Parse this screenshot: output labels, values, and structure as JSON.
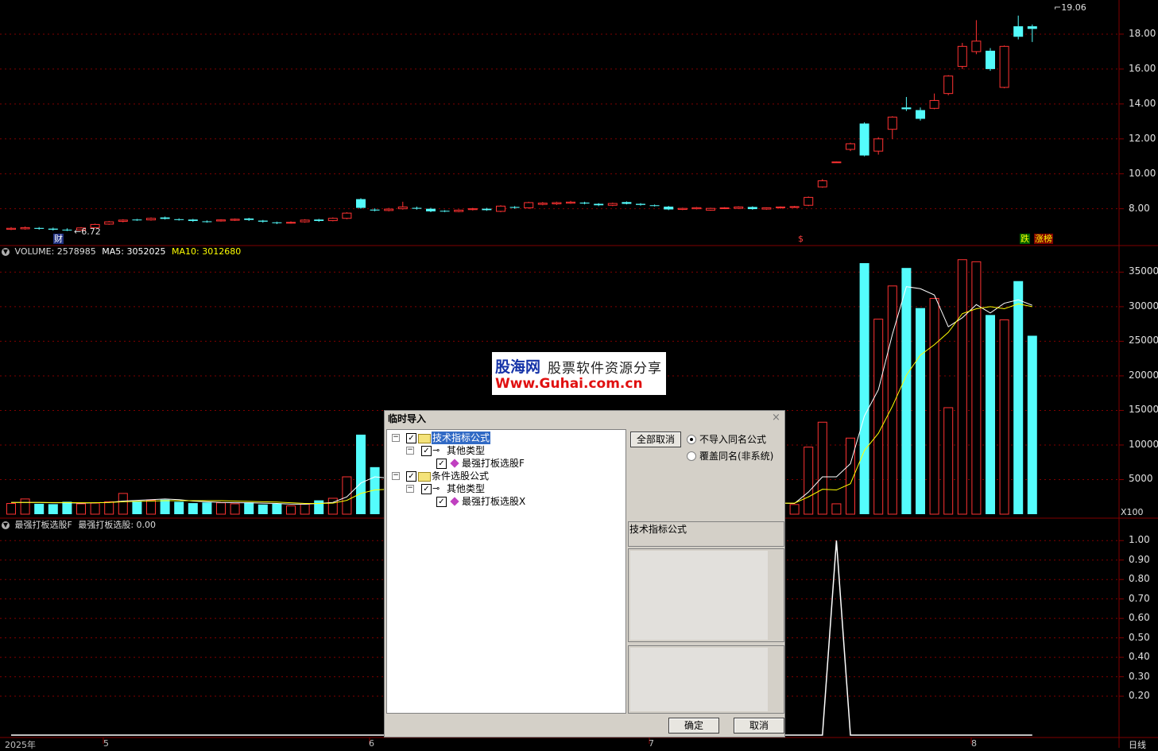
{
  "colors": {
    "up": "#ff3232",
    "down": "#54fcfc",
    "grid": "#800000",
    "ma5": "#ffffff",
    "ma10": "#ffff00",
    "vol_up": "#ff3232",
    "vol_down": "#54fcfc"
  },
  "price_axis": {
    "ticks": [
      "18.00",
      "16.00",
      "14.00",
      "12.00",
      "10.00",
      "8.00"
    ],
    "range": [
      6.3,
      19.5
    ]
  },
  "price_annotations": {
    "low": "6.72",
    "high": "19.06",
    "markers": [
      "财",
      "$",
      "跌",
      "涨榜"
    ]
  },
  "volume_panel": {
    "header_label": "VOLUME: 2578985",
    "ma5_label": "MA5: 3052025",
    "ma10_label": "MA10: 3012680",
    "ticks": [
      "35000",
      "30000",
      "25000",
      "20000",
      "15000",
      "10000",
      "5000"
    ],
    "unit": "X100",
    "range": [
      0,
      37000
    ]
  },
  "indicator_panel": {
    "header_name": "最强打板选股F",
    "header_value": "最强打板选股: 0.00",
    "ticks": [
      "1.00",
      "0.90",
      "0.80",
      "0.70",
      "0.60",
      "0.50",
      "0.40",
      "0.30",
      "0.20"
    ],
    "range": [
      0,
      1.05
    ]
  },
  "x_axis": {
    "labels": [
      "2025年",
      "5",
      "6",
      "7",
      "8"
    ],
    "period": "日线"
  },
  "chart_data": {
    "type": "candlestick",
    "title": "",
    "candles": [
      {
        "o": 6.82,
        "c": 6.88,
        "h": 6.95,
        "l": 6.78
      },
      {
        "o": 6.85,
        "c": 6.92,
        "h": 6.98,
        "l": 6.8
      },
      {
        "o": 6.9,
        "c": 6.85,
        "h": 6.95,
        "l": 6.8
      },
      {
        "o": 6.86,
        "c": 6.8,
        "h": 6.92,
        "l": 6.75
      },
      {
        "o": 6.8,
        "c": 6.78,
        "h": 6.88,
        "l": 6.72
      },
      {
        "o": 6.78,
        "c": 6.9,
        "h": 6.95,
        "l": 6.75
      },
      {
        "o": 6.92,
        "c": 7.1,
        "h": 7.15,
        "l": 6.9
      },
      {
        "o": 7.12,
        "c": 7.25,
        "h": 7.3,
        "l": 7.08
      },
      {
        "o": 7.28,
        "c": 7.35,
        "h": 7.4,
        "l": 7.22
      },
      {
        "o": 7.38,
        "c": 7.34,
        "h": 7.42,
        "l": 7.3
      },
      {
        "o": 7.36,
        "c": 7.45,
        "h": 7.5,
        "l": 7.32
      },
      {
        "o": 7.5,
        "c": 7.42,
        "h": 7.55,
        "l": 7.38
      },
      {
        "o": 7.4,
        "c": 7.36,
        "h": 7.45,
        "l": 7.32
      },
      {
        "o": 7.38,
        "c": 7.3,
        "h": 7.42,
        "l": 7.25
      },
      {
        "o": 7.28,
        "c": 7.26,
        "h": 7.33,
        "l": 7.2
      },
      {
        "o": 7.3,
        "c": 7.36,
        "h": 7.4,
        "l": 7.26
      },
      {
        "o": 7.34,
        "c": 7.4,
        "h": 7.44,
        "l": 7.3
      },
      {
        "o": 7.44,
        "c": 7.36,
        "h": 7.48,
        "l": 7.3
      },
      {
        "o": 7.32,
        "c": 7.26,
        "h": 7.36,
        "l": 7.2
      },
      {
        "o": 7.22,
        "c": 7.18,
        "h": 7.26,
        "l": 7.12
      },
      {
        "o": 7.18,
        "c": 7.22,
        "h": 7.28,
        "l": 7.14
      },
      {
        "o": 7.25,
        "c": 7.35,
        "h": 7.4,
        "l": 7.2
      },
      {
        "o": 7.38,
        "c": 7.3,
        "h": 7.42,
        "l": 7.25
      },
      {
        "o": 7.32,
        "c": 7.45,
        "h": 7.5,
        "l": 7.28
      },
      {
        "o": 7.45,
        "c": 7.75,
        "h": 7.8,
        "l": 7.4
      },
      {
        "o": 8.55,
        "c": 8.05,
        "h": 8.6,
        "l": 8.0
      },
      {
        "o": 7.95,
        "c": 7.9,
        "h": 8.02,
        "l": 7.85
      },
      {
        "o": 7.9,
        "c": 7.98,
        "h": 8.05,
        "l": 7.85
      },
      {
        "o": 8.0,
        "c": 8.1,
        "h": 8.4,
        "l": 7.95
      },
      {
        "o": 8.05,
        "c": 8.0,
        "h": 8.12,
        "l": 7.95
      },
      {
        "o": 8.0,
        "c": 7.85,
        "h": 8.05,
        "l": 7.8
      },
      {
        "o": 7.88,
        "c": 7.84,
        "h": 7.92,
        "l": 7.8
      },
      {
        "o": 7.84,
        "c": 7.92,
        "h": 7.96,
        "l": 7.8
      },
      {
        "o": 7.95,
        "c": 8.0,
        "h": 8.05,
        "l": 7.9
      },
      {
        "o": 8.0,
        "c": 7.92,
        "h": 8.05,
        "l": 7.88
      },
      {
        "o": 7.85,
        "c": 8.15,
        "h": 8.2,
        "l": 7.8
      },
      {
        "o": 8.1,
        "c": 8.05,
        "h": 8.15,
        "l": 8.0
      },
      {
        "o": 8.05,
        "c": 8.35,
        "h": 8.4,
        "l": 8.0
      },
      {
        "o": 8.25,
        "c": 8.32,
        "h": 8.38,
        "l": 8.2
      },
      {
        "o": 8.28,
        "c": 8.35,
        "h": 8.4,
        "l": 8.22
      },
      {
        "o": 8.32,
        "c": 8.38,
        "h": 8.45,
        "l": 8.28
      },
      {
        "o": 8.35,
        "c": 8.3,
        "h": 8.4,
        "l": 8.25
      },
      {
        "o": 8.28,
        "c": 8.2,
        "h": 8.32,
        "l": 8.15
      },
      {
        "o": 8.2,
        "c": 8.3,
        "h": 8.35,
        "l": 8.15
      },
      {
        "o": 8.38,
        "c": 8.28,
        "h": 8.42,
        "l": 8.25
      },
      {
        "o": 8.28,
        "c": 8.22,
        "h": 8.32,
        "l": 8.18
      },
      {
        "o": 8.2,
        "c": 8.16,
        "h": 8.24,
        "l": 8.12
      },
      {
        "o": 8.12,
        "c": 7.96,
        "h": 8.16,
        "l": 7.92
      },
      {
        "o": 7.96,
        "c": 8.02,
        "h": 8.06,
        "l": 7.92
      },
      {
        "o": 8.0,
        "c": 8.06,
        "h": 8.1,
        "l": 7.96
      },
      {
        "o": 7.92,
        "c": 8.02,
        "h": 8.06,
        "l": 7.88
      },
      {
        "o": 8.02,
        "c": 8.05,
        "h": 8.09,
        "l": 7.98
      },
      {
        "o": 8.02,
        "c": 8.1,
        "h": 8.14,
        "l": 7.98
      },
      {
        "o": 8.1,
        "c": 7.98,
        "h": 8.14,
        "l": 7.94
      },
      {
        "o": 7.98,
        "c": 8.05,
        "h": 8.08,
        "l": 7.94
      },
      {
        "o": 8.05,
        "c": 8.1,
        "h": 8.14,
        "l": 8.0
      },
      {
        "o": 8.1,
        "c": 8.12,
        "h": 8.16,
        "l": 8.05
      },
      {
        "o": 8.2,
        "c": 8.65,
        "h": 8.7,
        "l": 8.15
      },
      {
        "o": 9.25,
        "c": 9.6,
        "h": 9.7,
        "l": 9.2
      },
      {
        "o": 10.65,
        "c": 10.68,
        "h": 10.7,
        "l": 10.63
      },
      {
        "o": 11.4,
        "c": 11.72,
        "h": 11.78,
        "l": 11.3
      },
      {
        "o": 12.88,
        "c": 11.05,
        "h": 12.95,
        "l": 11.0
      },
      {
        "o": 11.3,
        "c": 12.0,
        "h": 12.1,
        "l": 11.1
      },
      {
        "o": 12.55,
        "c": 13.25,
        "h": 13.3,
        "l": 12.0
      },
      {
        "o": 13.8,
        "c": 13.7,
        "h": 14.4,
        "l": 13.6
      },
      {
        "o": 13.65,
        "c": 13.15,
        "h": 13.8,
        "l": 13.05
      },
      {
        "o": 13.75,
        "c": 14.2,
        "h": 14.6,
        "l": 13.7
      },
      {
        "o": 14.6,
        "c": 15.6,
        "h": 15.65,
        "l": 14.5
      },
      {
        "o": 16.15,
        "c": 17.3,
        "h": 17.5,
        "l": 16.0
      },
      {
        "o": 17.0,
        "c": 17.6,
        "h": 18.8,
        "l": 16.85
      },
      {
        "o": 17.05,
        "c": 16.0,
        "h": 17.2,
        "l": 15.9
      },
      {
        "o": 14.95,
        "c": 17.3,
        "h": 17.35,
        "l": 14.9
      },
      {
        "o": 18.45,
        "c": 17.85,
        "h": 19.06,
        "l": 17.7
      },
      {
        "o": 18.45,
        "c": 18.3,
        "h": 18.55,
        "l": 17.55
      }
    ],
    "volume": [
      1550,
      2200,
      1500,
      1450,
      1800,
      1500,
      1600,
      1800,
      3000,
      1900,
      2000,
      2100,
      1800,
      1600,
      1700,
      1650,
      1500,
      1700,
      1400,
      1500,
      1200,
      1450,
      2000,
      2300,
      5400,
      11500,
      6800,
      1500,
      1600,
      2200,
      1800,
      1600,
      1700,
      1500,
      1700,
      1800,
      1600,
      1700,
      1500,
      1600,
      1700,
      1500,
      1600,
      1700,
      1500,
      1500,
      1700,
      1500,
      1600,
      1700,
      1600,
      1500,
      1600,
      1700,
      1500,
      1600,
      1400,
      9700,
      13300,
      1500,
      11000,
      36300,
      28200,
      33000,
      35600,
      29800,
      31200,
      15400,
      36800,
      36500,
      28800,
      28100,
      33700,
      25800
    ],
    "volume_ma5": [
      1700,
      1700,
      1700,
      1650,
      1650,
      1600,
      1650,
      1700,
      1900,
      2000,
      2100,
      2200,
      2100,
      1900,
      1800,
      1700,
      1650,
      1650,
      1600,
      1550,
      1450,
      1450,
      1550,
      1700,
      2500,
      4500,
      5400,
      5200,
      5300,
      5700,
      4600,
      2000,
      1700,
      1700,
      1700,
      1700,
      1650,
      1650,
      1650,
      1650,
      1600,
      1650,
      1650,
      1650,
      1650,
      1600,
      1600,
      1600,
      1600,
      1650,
      1650,
      1600,
      1600,
      1650,
      1600,
      1600,
      1550,
      3200,
      5400,
      5400,
      7300,
      14200,
      18000,
      26000,
      32900,
      32600,
      31700,
      27100,
      28400,
      30300,
      29100,
      30500,
      31000,
      30200
    ],
    "volume_ma10": [
      1700,
      1700,
      1700,
      1680,
      1680,
      1650,
      1650,
      1700,
      1800,
      1850,
      1900,
      1950,
      1950,
      1950,
      1950,
      1950,
      1900,
      1850,
      1800,
      1750,
      1650,
      1550,
      1550,
      1600,
      2000,
      3000,
      3500,
      3600,
      3700,
      4100,
      3600,
      3200,
      3400,
      3500,
      3700,
      3200,
      1800,
      1700,
      1700,
      1650,
      1650,
      1650,
      1650,
      1650,
      1650,
      1650,
      1650,
      1650,
      1650,
      1650,
      1650,
      1600,
      1600,
      1650,
      1650,
      1600,
      1600,
      2500,
      3600,
      3500,
      4400,
      9200,
      11700,
      15600,
      20100,
      23000,
      24500,
      26300,
      29000,
      29700,
      30000,
      29700,
      30400,
      30000
    ],
    "signal": [
      0,
      0,
      0,
      0,
      0,
      0,
      0,
      0,
      0,
      0,
      0,
      0,
      0,
      0,
      0,
      0,
      0,
      0,
      0,
      0,
      0,
      0,
      0,
      0,
      0,
      0,
      0,
      0,
      0,
      0,
      0,
      0,
      0,
      0,
      0,
      0,
      0,
      0,
      0,
      0,
      0,
      0,
      0,
      0,
      0,
      0,
      0,
      0,
      0,
      0,
      0,
      0,
      0,
      0,
      0,
      0,
      0,
      0,
      0,
      1,
      0,
      0,
      0,
      0,
      0,
      0,
      0,
      0,
      0,
      0,
      0,
      0,
      0,
      0
    ]
  },
  "watermark": {
    "line1a": "股海网",
    "line1b": "股票软件资源分享",
    "line2": "Www.Guhai.com.cn"
  },
  "dialog": {
    "title": "临时导入",
    "tree": [
      {
        "expander": "−",
        "label": "技术指标公式",
        "level": 0,
        "selected": true,
        "kind": "folder"
      },
      {
        "expander": "−",
        "label": "其他类型",
        "level": 1,
        "selected": false,
        "kind": "key"
      },
      {
        "expander": "",
        "label": "最强打板选股F",
        "level": 2,
        "selected": false,
        "kind": "formula"
      },
      {
        "expander": "−",
        "label": "条件选股公式",
        "level": 0,
        "selected": false,
        "kind": "folder"
      },
      {
        "expander": "−",
        "label": "其他类型",
        "level": 1,
        "selected": false,
        "kind": "key"
      },
      {
        "expander": "",
        "label": "最强打板选股X",
        "level": 2,
        "selected": false,
        "kind": "formula"
      }
    ],
    "deselect_all": "全部取消",
    "radio_skip": "不导入同名公式",
    "radio_overwrite": "覆盖同名(非系统)",
    "info_label": "技术指标公式",
    "ok": "确定",
    "cancel": "取消"
  }
}
